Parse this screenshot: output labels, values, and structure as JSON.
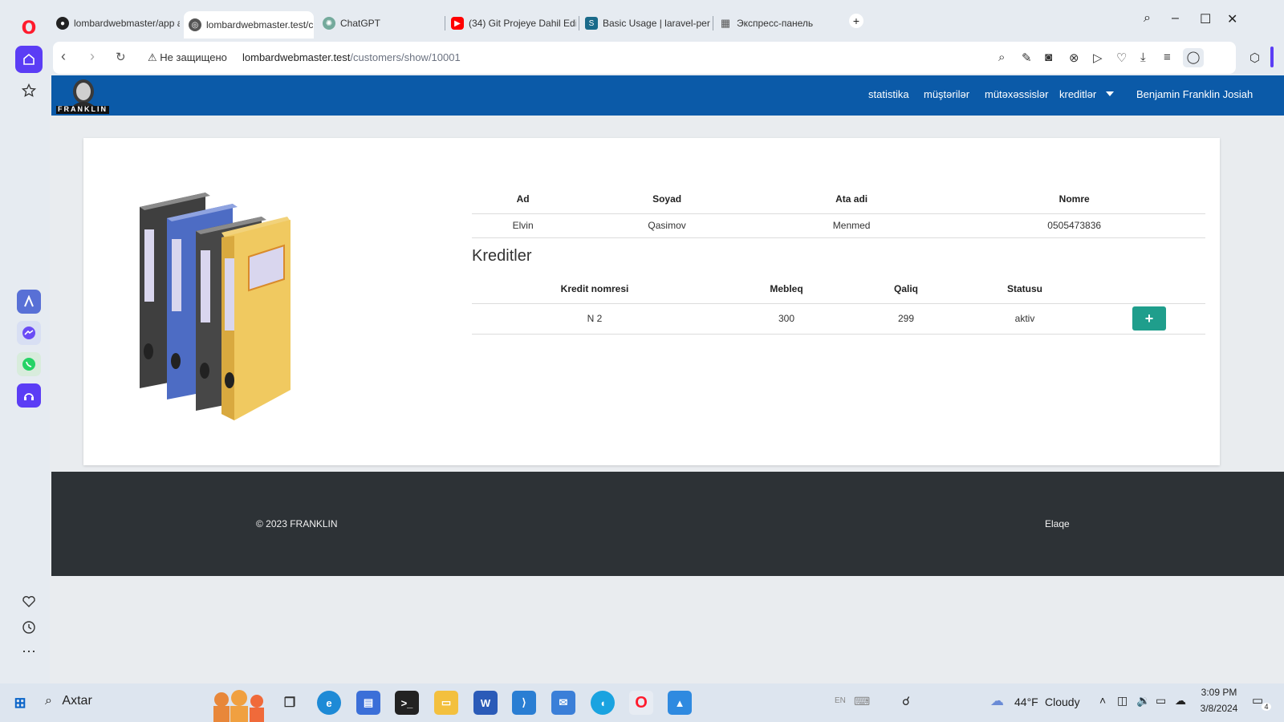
{
  "browser": {
    "tabs": [
      {
        "label": "lombardwebmaster/app a",
        "fav_color": "#222222"
      },
      {
        "label": "lombardwebmaster.test/c",
        "fav_color": "#555555"
      },
      {
        "label": "ChatGPT",
        "fav_color": "#74aa9c"
      },
      {
        "label": "(34) Git Projeye Dahil Edil",
        "fav_color": "#ff0000"
      },
      {
        "label": "Basic Usage | laravel-perm",
        "fav_color": "#1a6a8a"
      },
      {
        "label": "Экспресс-панель",
        "fav_color": "#888888"
      }
    ],
    "security_label": "Не защищено",
    "url_host": "lombardwebmaster.test",
    "url_path": "/customers/show/10001"
  },
  "site": {
    "brand": "FRANKLIN",
    "nav": {
      "statistics": "statistika",
      "customers": "müştərilər",
      "specialists": "mütəxəssislər",
      "credits": "kreditlər",
      "user": "Benjamin Franklin Josiah"
    },
    "customer_table": {
      "headers": [
        "Ad",
        "Soyad",
        "Ata adi",
        "Nomre"
      ],
      "rows": [
        [
          "Elvin",
          "Qasimov",
          "Menmed",
          "0505473836"
        ]
      ]
    },
    "credits_title": "Kreditler",
    "credits_table": {
      "headers": [
        "Kredit nomresi",
        "Mebleq",
        "Qaliq",
        "Statusu"
      ],
      "rows": [
        [
          "N 2",
          "300",
          "299",
          "aktiv"
        ]
      ],
      "add_label": "+"
    },
    "footer": {
      "copyright": "© 2023 FRANKLIN",
      "contact": "Elaqe"
    }
  },
  "taskbar": {
    "search_label": "Axtar",
    "weather_temp": "44°F",
    "weather_text": "Cloudy",
    "time": "3:09 PM",
    "date": "3/8/2024",
    "notif_count": "4",
    "lang": "EN"
  }
}
